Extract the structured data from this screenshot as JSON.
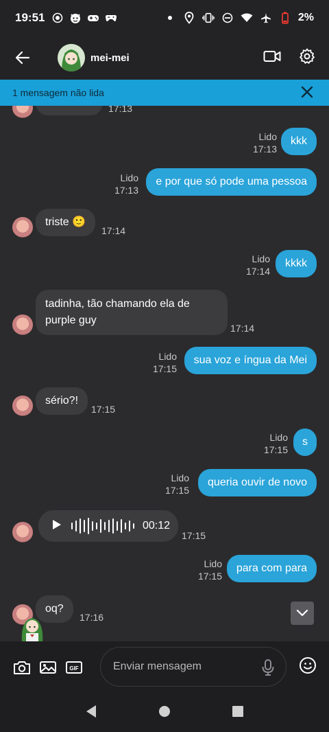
{
  "status_bar": {
    "time": "19:51",
    "battery": "2%"
  },
  "header": {
    "name": "mei-mei"
  },
  "banner": {
    "text": "1 mensagem não lida"
  },
  "messages": [
    {
      "dir": "in",
      "text": "",
      "time": "17:13"
    },
    {
      "dir": "out",
      "text": "kkk",
      "status": "Lido",
      "time": "17:13"
    },
    {
      "dir": "out",
      "text": "e por que só pode uma pessoa",
      "status": "Lido",
      "time": "17:13"
    },
    {
      "dir": "in",
      "text": "triste 🙂",
      "time": "17:14"
    },
    {
      "dir": "out",
      "text": "kkkk",
      "status": "Lido",
      "time": "17:14"
    },
    {
      "dir": "in",
      "text": "tadinha, tão chamando ela de purple guy",
      "time": "17:14"
    },
    {
      "dir": "out",
      "text": "sua voz e íngua da Mei",
      "status": "Lido",
      "time": "17:15"
    },
    {
      "dir": "in",
      "text": "sério?!",
      "time": "17:15"
    },
    {
      "dir": "out",
      "text": "s",
      "status": "Lido",
      "time": "17:15"
    },
    {
      "dir": "out",
      "text": "queria ouvir de novo",
      "status": "Lido",
      "time": "17:15"
    },
    {
      "dir": "in",
      "type": "audio",
      "duration": "00:12",
      "time": "17:15"
    },
    {
      "dir": "out",
      "text": "para com para",
      "status": "Lido",
      "time": "17:15"
    },
    {
      "dir": "in",
      "text": "oq?",
      "time": "17:16"
    }
  ],
  "composer": {
    "placeholder": "Enviar mensagem",
    "gif_label": "GIF"
  },
  "colors": {
    "accent": "#2aa4d9",
    "banner": "#1aa0d8",
    "background": "#2b2b2d",
    "incoming_bubble": "#3c3c3f"
  }
}
